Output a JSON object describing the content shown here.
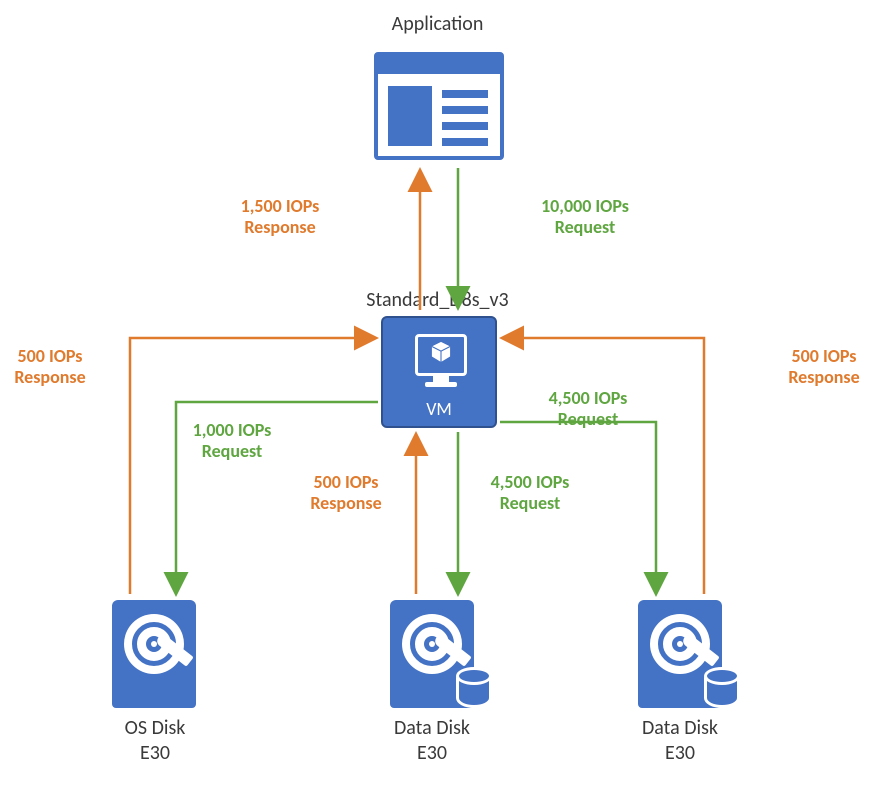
{
  "title": "Application",
  "vm": {
    "sku": "Standard_D8s_v3",
    "label": "VM"
  },
  "flows": {
    "app_response": {
      "iops": "1,500 IOPs",
      "kind": "Response"
    },
    "app_request": {
      "iops": "10,000 IOPs",
      "kind": "Request"
    },
    "os_response": {
      "iops": "500 IOPs",
      "kind": "Response"
    },
    "os_request": {
      "iops": "1,000 IOPs",
      "kind": "Request"
    },
    "d1_response": {
      "iops": "500 IOPs",
      "kind": "Response"
    },
    "d1_request": {
      "iops": "4,500 IOPs",
      "kind": "Request"
    },
    "d2_response": {
      "iops": "500 IOPs",
      "kind": "Response"
    },
    "d2_request": {
      "iops": "4,500 IOPs",
      "kind": "Request"
    }
  },
  "disks": {
    "os": {
      "name": "OS Disk",
      "tier": "E30"
    },
    "d1": {
      "name": "Data Disk",
      "tier": "E30"
    },
    "d2": {
      "name": "Data Disk",
      "tier": "E30"
    }
  },
  "colors": {
    "shape": "#4472c4",
    "request": "#5fa641",
    "response": "#e07b2e"
  }
}
